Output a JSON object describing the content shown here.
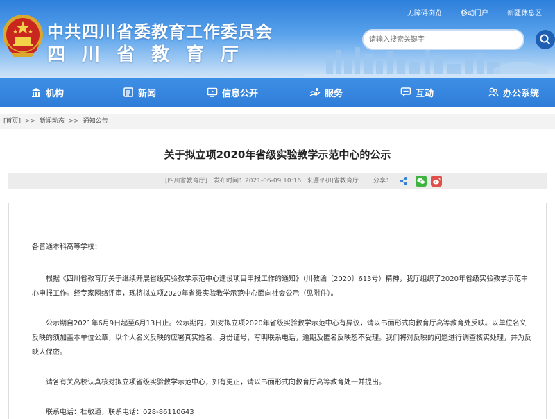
{
  "header": {
    "title": "中共四川省委教育工作委员会",
    "subtitle": "四川省教育厅",
    "top_links": [
      "无障碍浏览",
      "移动门户",
      "新疆休息区"
    ],
    "search_placeholder": "请输入搜索关键字",
    "brand_color": "#2f7dd8"
  },
  "nav": {
    "items": [
      {
        "label": "机构",
        "icon": "building-icon"
      },
      {
        "label": "新闻",
        "icon": "news-icon"
      },
      {
        "label": "信息公开",
        "icon": "monitor-icon"
      },
      {
        "label": "服务",
        "icon": "service-icon"
      },
      {
        "label": "互动",
        "icon": "chat-icon"
      },
      {
        "label": "办公系统",
        "icon": "users-icon"
      }
    ]
  },
  "breadcrumb": {
    "items": [
      "[首页]",
      "新闻动态",
      "通知公告"
    ],
    "separator": ">>"
  },
  "article": {
    "title": "关于拟立项2020年省级实验教学示范中心的公示",
    "source_tag": "[四川省教育厅]",
    "publish_time": "发布时间：2021-06-09 10:16",
    "origin": "来源:四川省教育厅",
    "share_label": "分享：",
    "share_icons": [
      "share-icon",
      "wechat-icon",
      "weibo-icon"
    ],
    "paragraphs": [
      "各普通本科高等学校：",
      "根据《四川省教育厅关于继续开展省级实验教学示范中心建设项目申报工作的通知》（川教函〔2020〕613号）精神，我厅组织了2020年省级实验教学示范中心申报工作。经专家网络评审，现将拟立项2020年省级实验教学示范中心面向社会公示（见附件）。",
      "公示期自2021年6月9日起至6月13日止。公示期内，如对拟立项2020年省级实验教学示范中心有异议，请以书面形式向教育厅高等教育处反映。以单位名义反映的须加盖本单位公章，以个人名义反映的应署真实姓名、身份证号，写明联系电话，逾期及匿名反映恕不受理。我们将对反映的问题进行调查核实处理，并为反映人保密。",
      "请各有关高校认真核对拟立项省级实验教学示范中心，如有更正，请以书面形式向教育厅高等教育处一并提出。",
      "联系电话：杜敬通，联系电话：028-86110643"
    ]
  }
}
